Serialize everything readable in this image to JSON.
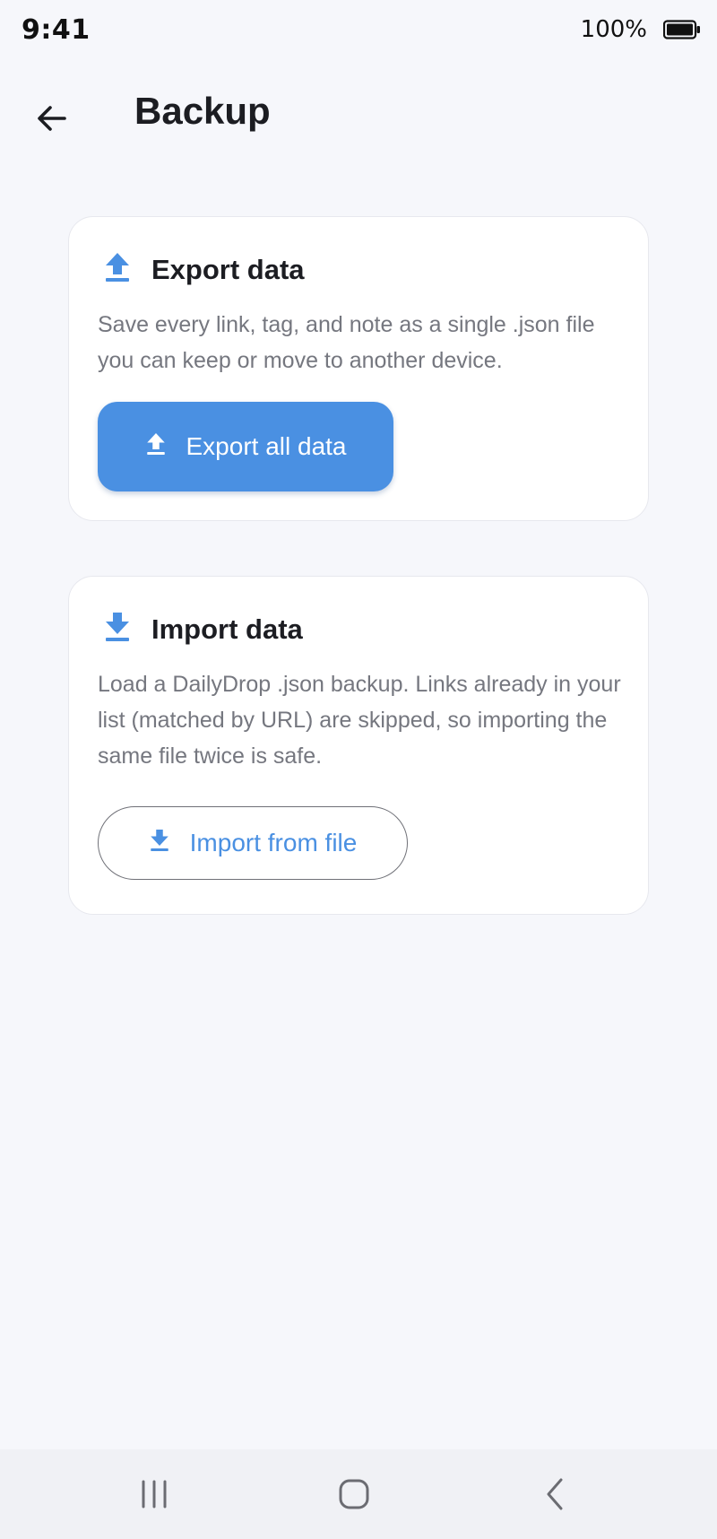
{
  "status_bar": {
    "time": "9:41",
    "battery": "100%"
  },
  "app_bar": {
    "title": "Backup"
  },
  "export_card": {
    "title": "Export data",
    "description": "Save every link, tag, and note as a single .json file you can keep or move to another device.",
    "button_label": "Export all data",
    "icon": "upload-icon"
  },
  "import_card": {
    "title": "Import data",
    "description": "Load a DailyDrop .json backup. Links already in your list (matched by URL) are skipped, so importing the same file twice is safe.",
    "button_label": "Import from file",
    "icon": "download-icon"
  },
  "colors": {
    "accent": "#4a90e2",
    "background": "#f6f7fb",
    "card": "#ffffff",
    "text_secondary": "#75777f"
  }
}
